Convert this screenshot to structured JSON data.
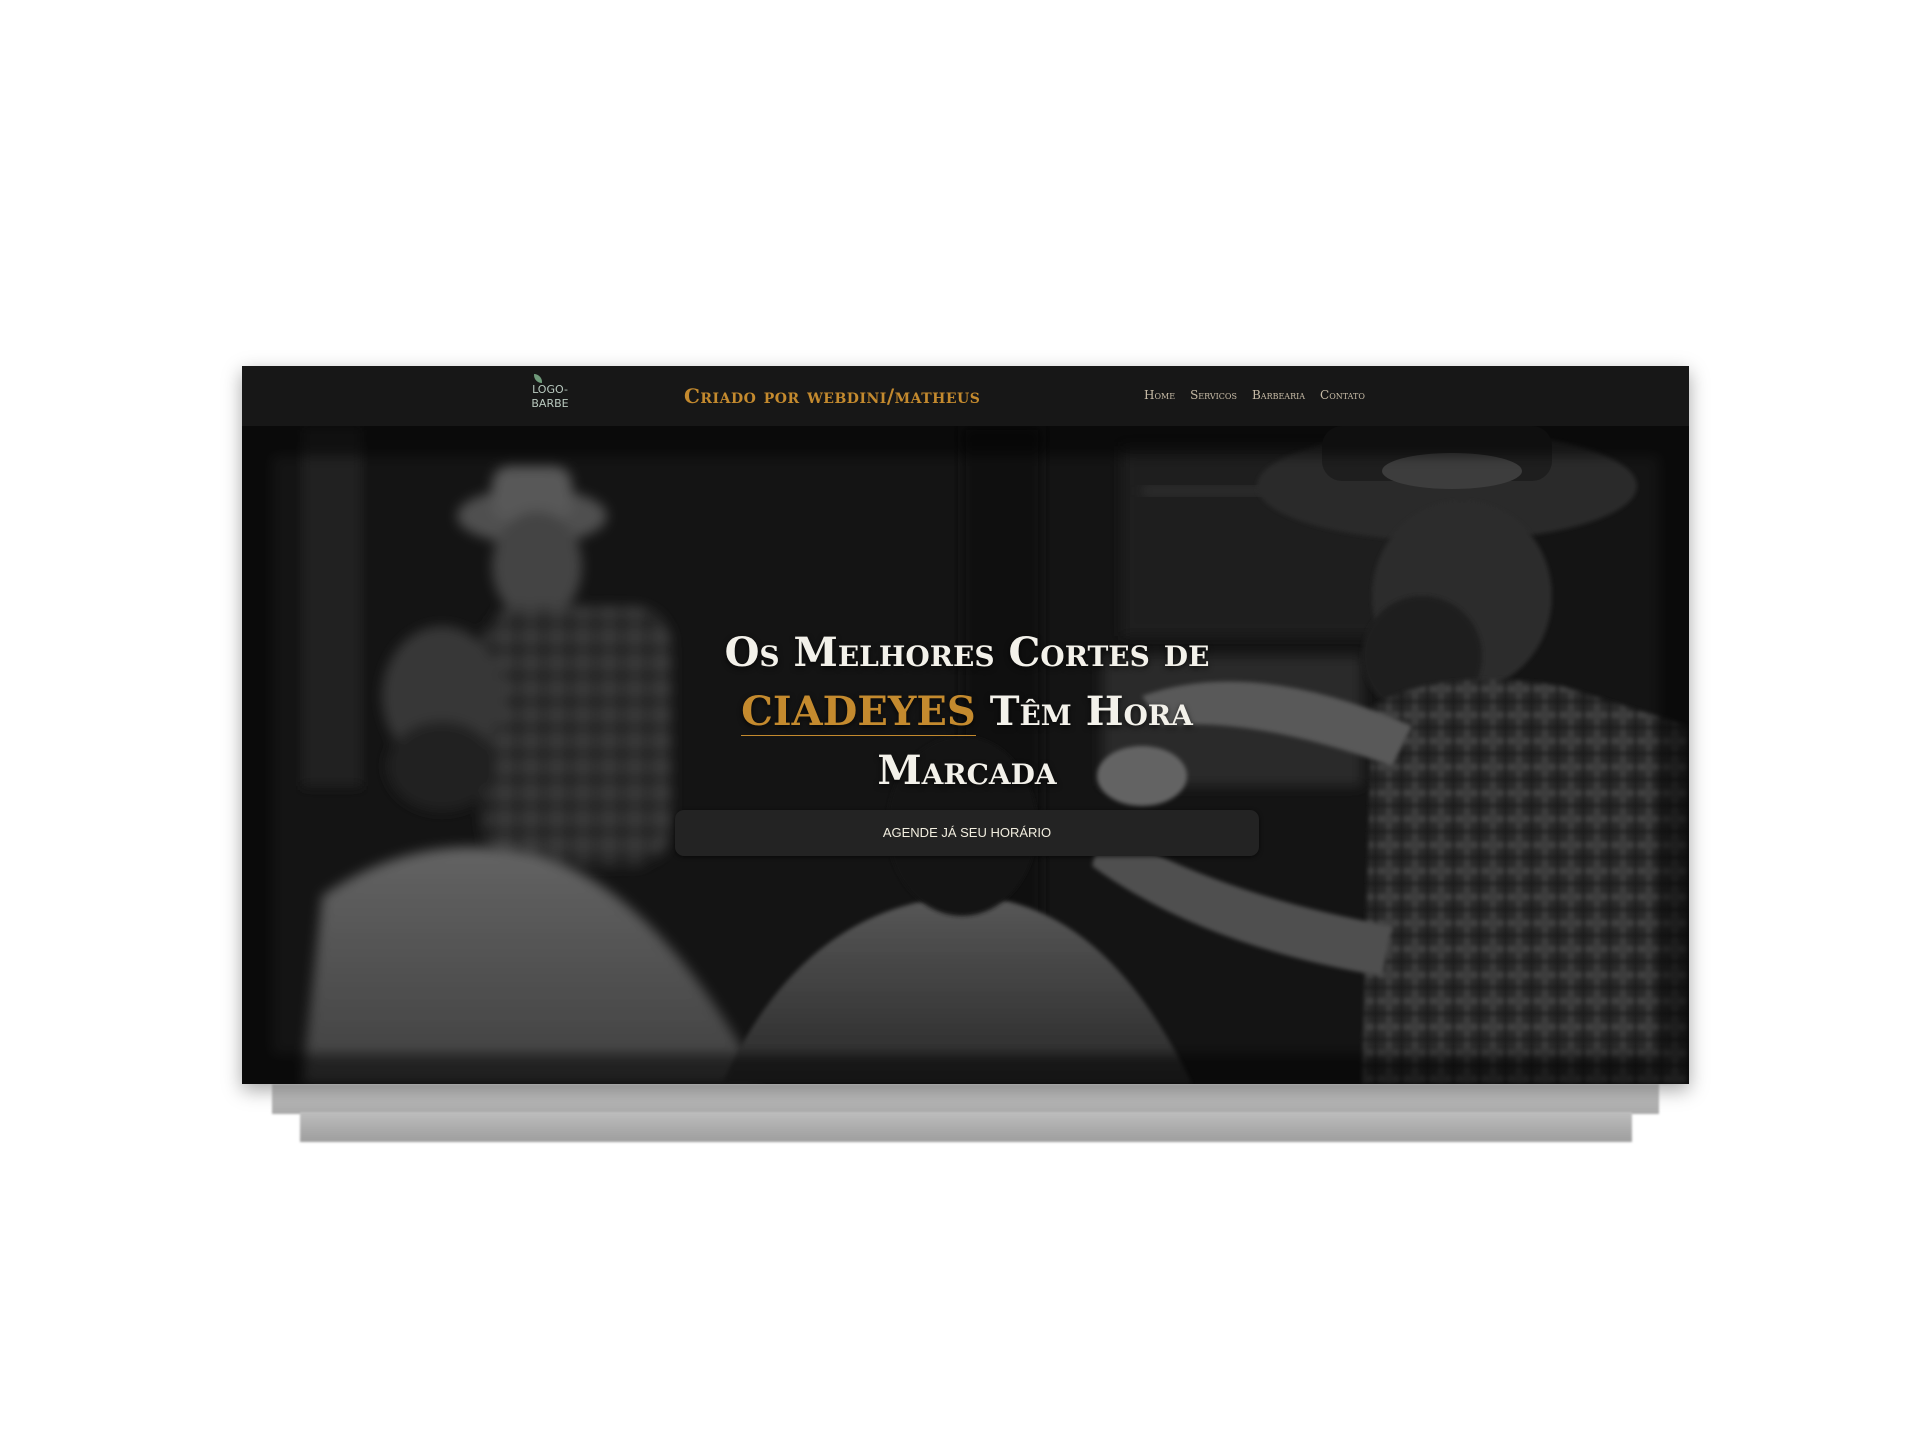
{
  "header": {
    "logo_alt": "LOGO-BARBE",
    "brand": "Criado por webdini/matheus",
    "nav": [
      {
        "label": "Home"
      },
      {
        "label": "Servicos"
      },
      {
        "label": "Barbearia"
      },
      {
        "label": "Contato"
      }
    ]
  },
  "hero": {
    "line1": "Os Melhores Cortes de",
    "accent": "CIADEYES",
    "line2_rest": " Têm Hora",
    "line3": "Marcada",
    "cta_label": "AGENDE JÁ SEU HORÁRIO",
    "background_image": "black-and-white-barbershop-photo"
  },
  "colors": {
    "accent": "#c48a2e",
    "header_bg": "#171717",
    "button_bg": "#232323",
    "headline": "#f3f1ea"
  }
}
